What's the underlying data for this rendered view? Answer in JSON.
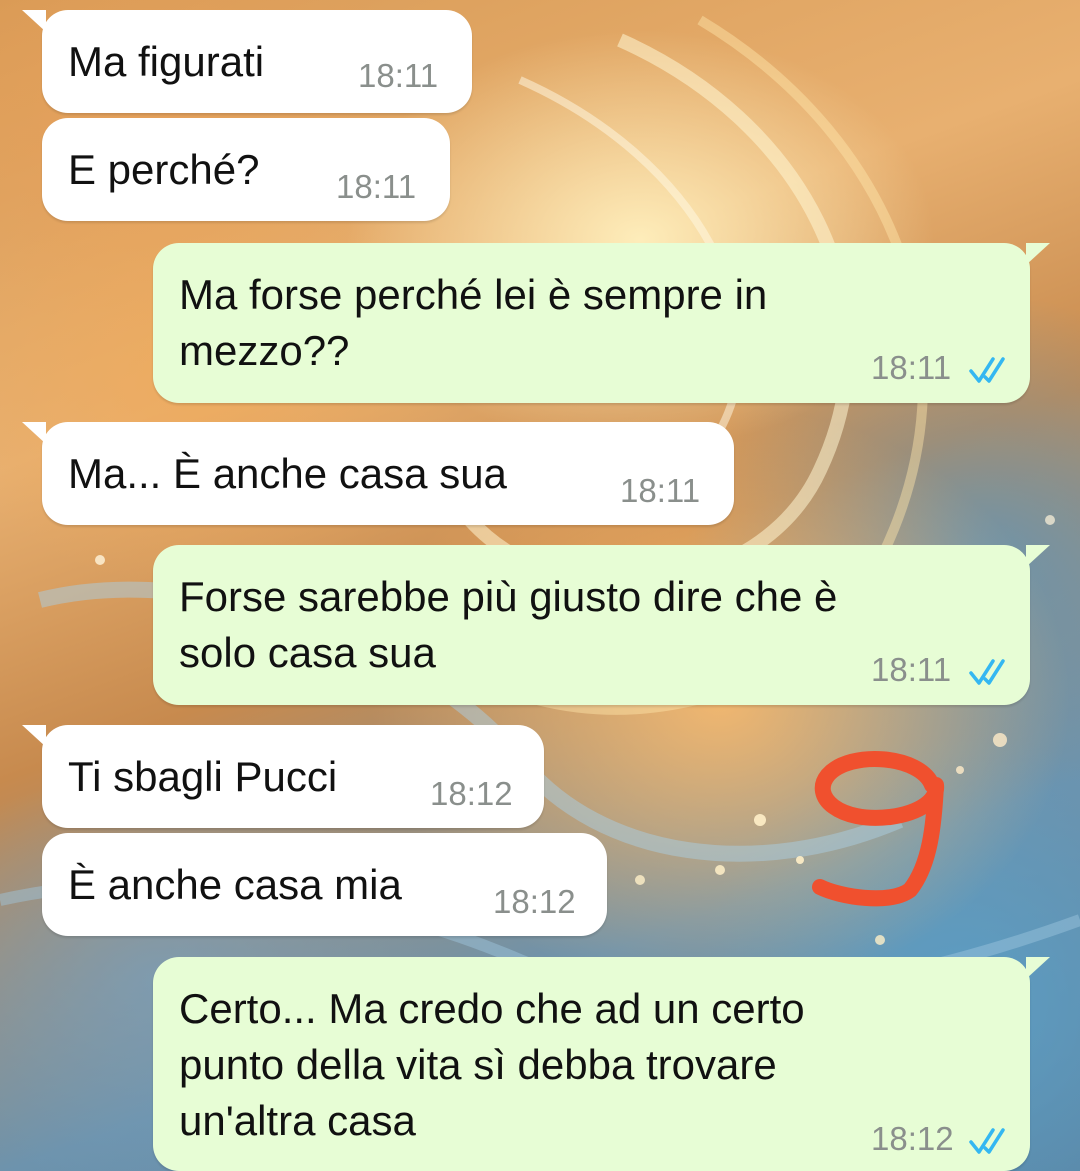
{
  "chat": {
    "messages": [
      {
        "direction": "incoming",
        "text": "Ma figurati",
        "time": "18:11"
      },
      {
        "direction": "incoming",
        "text": "E perché?",
        "time": "18:11"
      },
      {
        "direction": "outgoing",
        "text": "Ma forse perché lei è sempre in\nmezzo??",
        "time": "18:11",
        "status": "read"
      },
      {
        "direction": "incoming",
        "text": "Ma... È anche casa sua",
        "time": "18:11"
      },
      {
        "direction": "outgoing",
        "text": "Forse sarebbe più giusto dire che è\nsolo casa sua",
        "time": "18:11",
        "status": "read"
      },
      {
        "direction": "incoming",
        "text": "Ti sbagli Pucci",
        "time": "18:12"
      },
      {
        "direction": "incoming",
        "text": "È anche casa mia",
        "time": "18:12"
      },
      {
        "direction": "outgoing",
        "text": "Certo... Ma credo che ad un certo\npunto della vita sì debba trovare\nun'altra casa",
        "time": "18:12",
        "status": "read"
      }
    ]
  },
  "icons": {
    "read_receipt": "double-check-icon",
    "annotation": "handwritten-nine-mark"
  },
  "colors": {
    "incoming_bubble": "#ffffff",
    "outgoing_bubble": "#e7fdd5",
    "read_tick": "#34b7f1",
    "annotation_stroke": "#f0502e"
  }
}
